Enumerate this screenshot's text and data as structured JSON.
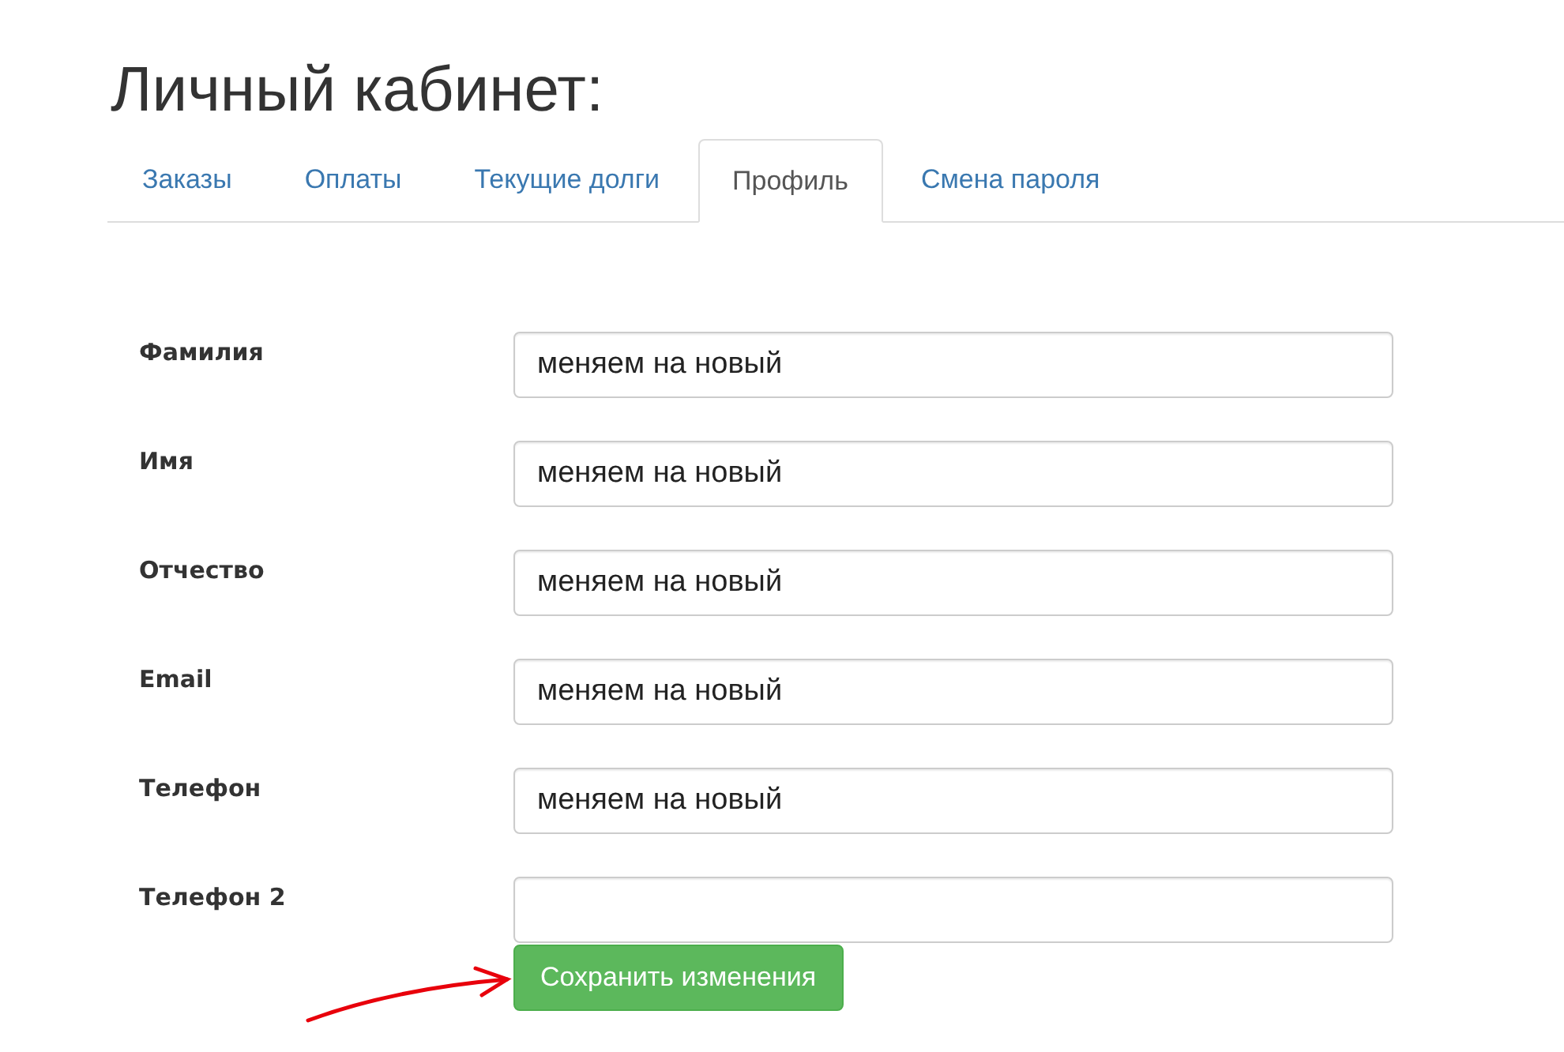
{
  "title": "Личный кабинет:",
  "tabs": [
    {
      "label": "Заказы",
      "selected": false
    },
    {
      "label": "Оплаты",
      "selected": false
    },
    {
      "label": "Текущие долги",
      "selected": false
    },
    {
      "label": "Профиль",
      "selected": true
    },
    {
      "label": "Смена пароля",
      "selected": false
    }
  ],
  "fields": [
    {
      "label": "Фамилия",
      "value": "меняем на новый"
    },
    {
      "label": "Имя",
      "value": "меняем на новый"
    },
    {
      "label": "Отчество",
      "value": "меняем на новый"
    },
    {
      "label": "Email",
      "value": "меняем на новый"
    },
    {
      "label": "Телефон",
      "value": "меняем на новый"
    },
    {
      "label": "Телефон 2"
    }
  ],
  "save_button": "Сохранить изменения"
}
